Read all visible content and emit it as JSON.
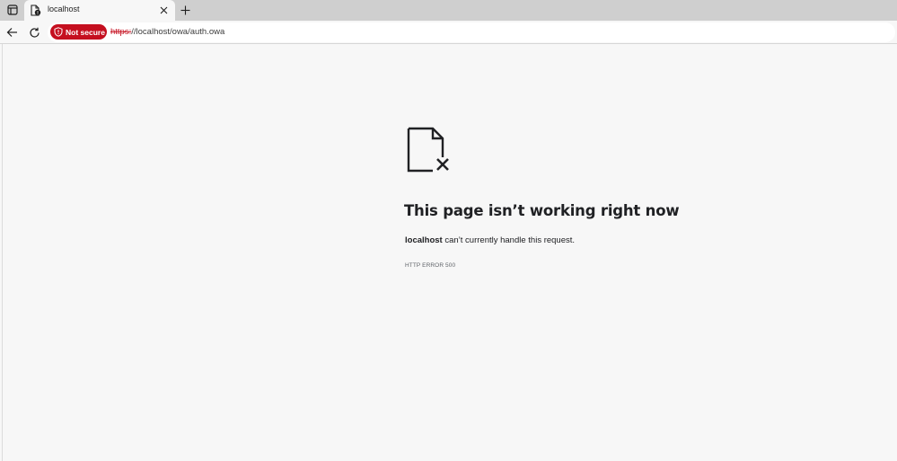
{
  "tab": {
    "title": "localhost"
  },
  "address_bar": {
    "security_label": "Not secure",
    "url_scheme": "https:",
    "url_rest": "//localhost/owa/auth.owa"
  },
  "error_page": {
    "title": "This page isn’t working right now",
    "host": "localhost",
    "message": " can’t currently handle this request.",
    "code": "HTTP ERROR 500"
  },
  "colors": {
    "not_secure": "#c50f1f",
    "page_background": "#f7f7f7",
    "tabstrip_background": "#cfcfcf"
  },
  "icons": {
    "tab_actions": "tab-actions-icon",
    "favicon": "page-favicon-icon",
    "close": "close-icon",
    "new_tab": "plus-icon",
    "back": "back-arrow-icon",
    "reload": "reload-icon",
    "security": "shield-warning-icon",
    "error": "broken-document-icon"
  }
}
